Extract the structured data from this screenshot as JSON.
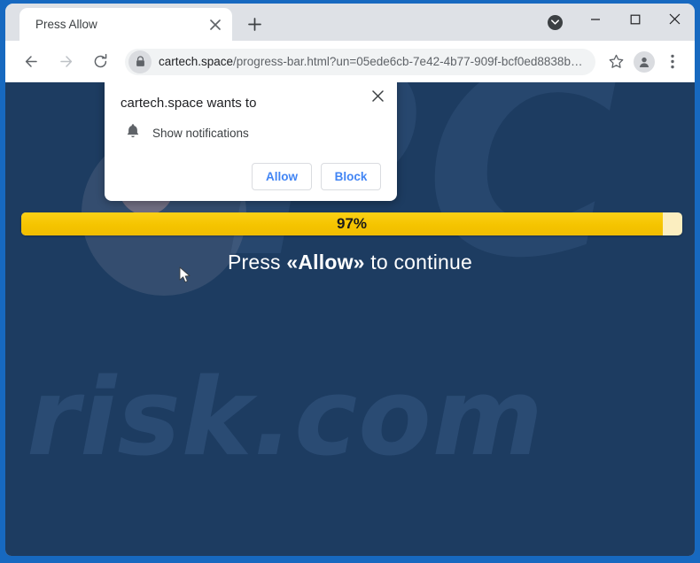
{
  "window": {
    "minimize_label": "Minimize",
    "maximize_label": "Maximize",
    "close_label": "Close"
  },
  "tabstrip": {
    "tab_title": "Press Allow",
    "tab_close_label": "×",
    "new_tab_label": "+",
    "tab_search_label": "Search tabs"
  },
  "toolbar": {
    "back_label": "←",
    "forward_label": "→",
    "reload_label": "⟳",
    "url_host": "cartech.space",
    "url_path": "/progress-bar.html?un=05ede6cb-7e42-4b77-909f-bcf0ed8838b…",
    "url_full": "cartech.space/progress-bar.html?un=05ede6cb-7e42-4b77-909f-bcf0ed8838b…",
    "bookmark_label": "Bookmark this tab",
    "profile_label": "Profile",
    "menu_label": "Customize and control Google Chrome"
  },
  "permission_dialog": {
    "title": "cartech.space wants to",
    "permission_label": "Show notifications",
    "allow_label": "Allow",
    "block_label": "Block",
    "close_label": "×"
  },
  "page": {
    "progress_percent_label": "97%",
    "progress_percent_value": 97,
    "cta_prefix": "Press ",
    "cta_emphasis": "«Allow»",
    "cta_suffix": " to continue",
    "watermark_top": "PC",
    "watermark_bottom": "risk.com"
  },
  "colors": {
    "page_background": "#1d3c61",
    "frame_blue": "#1769c0",
    "progress_fill": "#f5c400",
    "progress_track": "#fbeec0",
    "tabstrip_background": "#dee1e6",
    "link_blue": "#4285f4"
  }
}
